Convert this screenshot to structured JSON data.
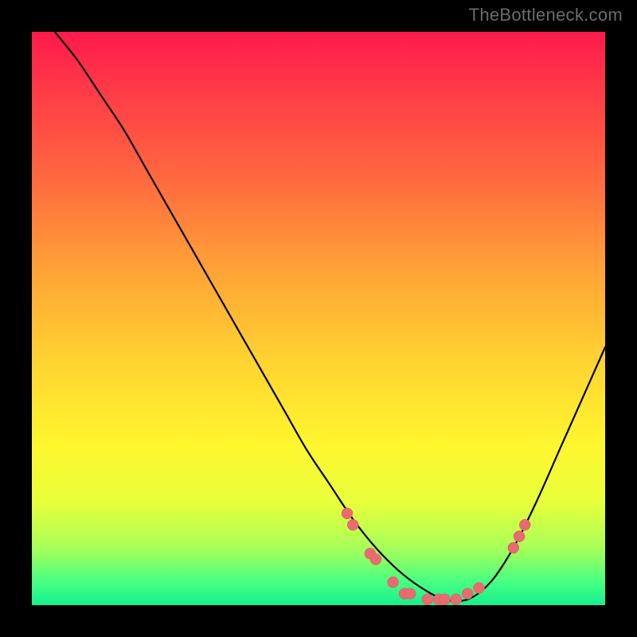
{
  "watermark": "TheBottleneck.com",
  "colors": {
    "page_bg": "#000000",
    "curve": "#000000",
    "dot_fill": "#e96a6f",
    "dot_stroke": "#d85b60",
    "gradient_stops": [
      "#ff1a4b",
      "#ff3a47",
      "#ff6a3f",
      "#ffa436",
      "#ffd531",
      "#fff62f",
      "#e8ff3a",
      "#a8ff59",
      "#47ff82",
      "#14f08e"
    ]
  },
  "chart_data": {
    "type": "line",
    "title": "",
    "xlabel": "",
    "ylabel": "",
    "xlim": [
      0,
      100
    ],
    "ylim": [
      0,
      100
    ],
    "grid": false,
    "legend": false,
    "series": [
      {
        "name": "bottleneck-curve",
        "x": [
          4,
          8,
          12,
          16,
          20,
          24,
          28,
          32,
          36,
          40,
          44,
          48,
          52,
          56,
          60,
          64,
          68,
          72,
          76,
          80,
          84,
          88,
          92,
          96,
          100
        ],
        "y": [
          100,
          95,
          89,
          83,
          76,
          69,
          62,
          55,
          48,
          41,
          34,
          27,
          21,
          15,
          10,
          6,
          3,
          1,
          1,
          4,
          10,
          18,
          27,
          36,
          45
        ]
      }
    ],
    "scatter": [
      {
        "x": 55,
        "y": 16
      },
      {
        "x": 56,
        "y": 14
      },
      {
        "x": 59,
        "y": 9
      },
      {
        "x": 60,
        "y": 8
      },
      {
        "x": 63,
        "y": 4
      },
      {
        "x": 65,
        "y": 2
      },
      {
        "x": 66,
        "y": 2
      },
      {
        "x": 69,
        "y": 1
      },
      {
        "x": 71,
        "y": 1
      },
      {
        "x": 72,
        "y": 1
      },
      {
        "x": 74,
        "y": 1
      },
      {
        "x": 76,
        "y": 2
      },
      {
        "x": 78,
        "y": 3
      },
      {
        "x": 84,
        "y": 10
      },
      {
        "x": 85,
        "y": 12
      },
      {
        "x": 86,
        "y": 14
      }
    ],
    "background": {
      "type": "vertical-gradient",
      "meaning": "red=high bottleneck, green=optimal",
      "stops": [
        {
          "pos": 0.0,
          "color": "#ff1a4b"
        },
        {
          "pos": 0.1,
          "color": "#ff3a47"
        },
        {
          "pos": 0.26,
          "color": "#ff6a3f"
        },
        {
          "pos": 0.42,
          "color": "#ffa436"
        },
        {
          "pos": 0.58,
          "color": "#ffd531"
        },
        {
          "pos": 0.72,
          "color": "#fff62f"
        },
        {
          "pos": 0.82,
          "color": "#e8ff3a"
        },
        {
          "pos": 0.9,
          "color": "#a8ff59"
        },
        {
          "pos": 0.96,
          "color": "#47ff82"
        },
        {
          "pos": 1.0,
          "color": "#14f08e"
        }
      ]
    }
  }
}
